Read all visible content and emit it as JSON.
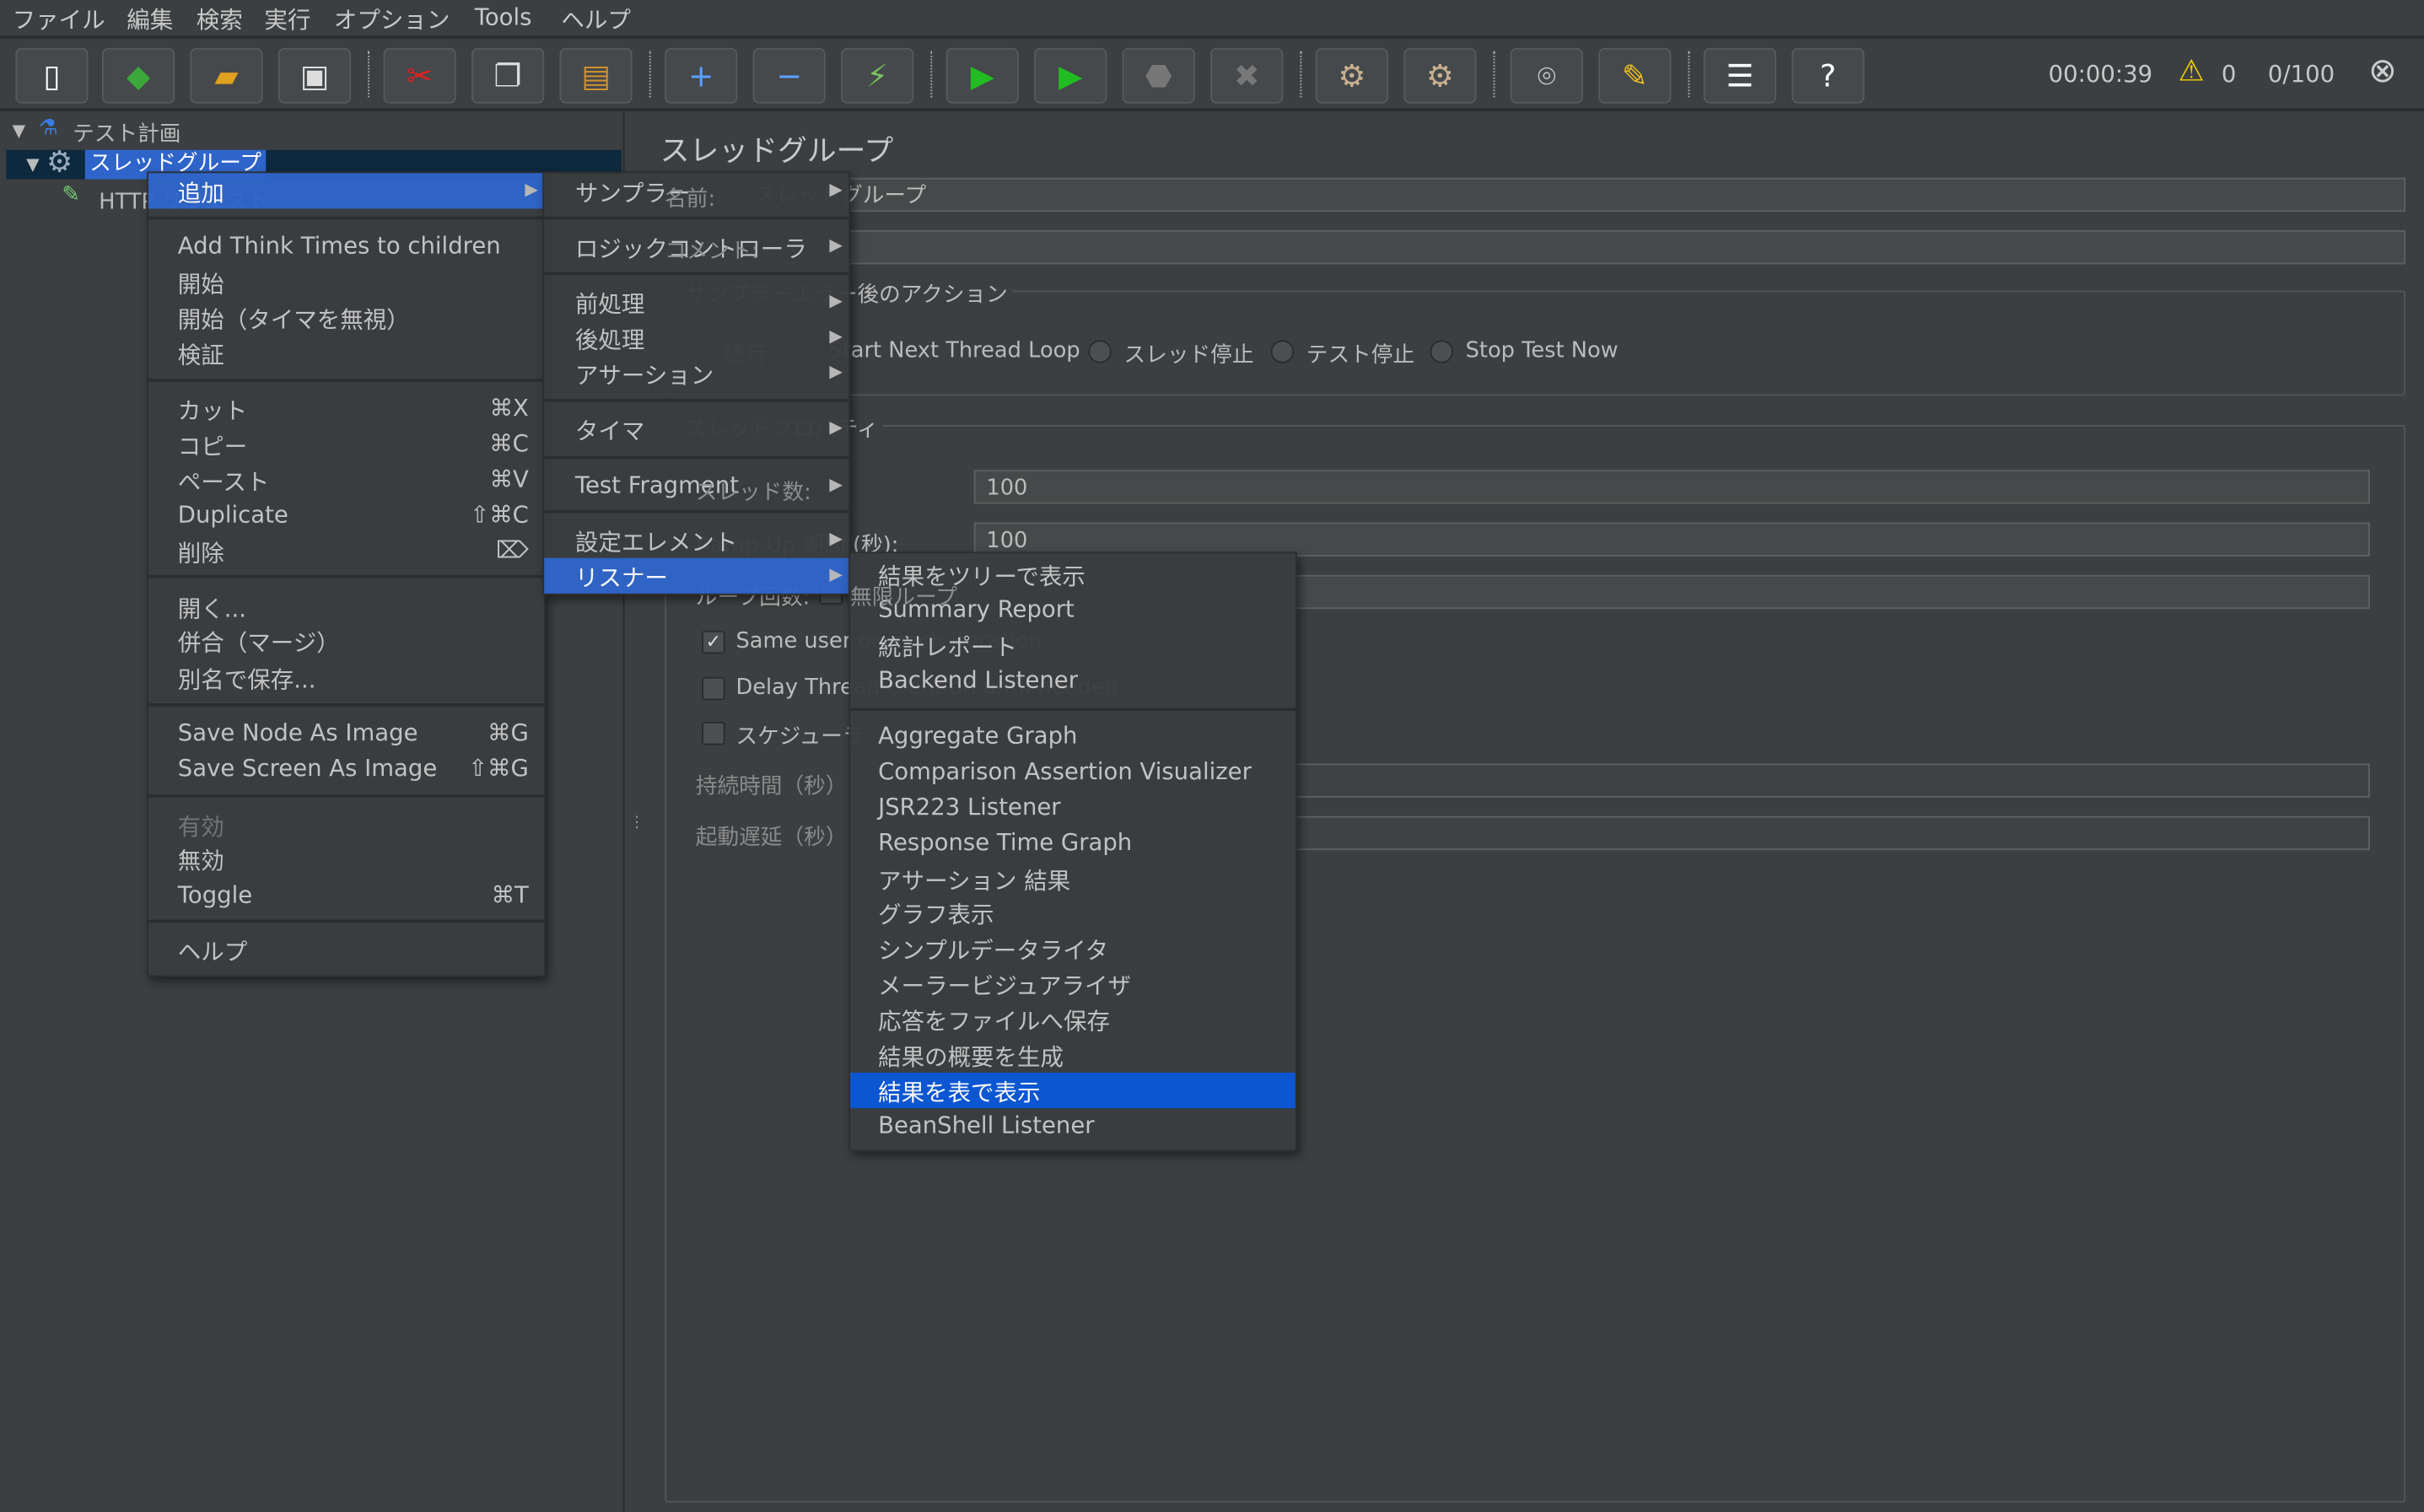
{
  "menubar": [
    "ファイル",
    "編集",
    "検索",
    "実行",
    "オプション",
    "Tools",
    "ヘルプ"
  ],
  "toolbar": {
    "buttons": [
      {
        "name": "new-icon",
        "glyph": "▯",
        "color": "#ffffff"
      },
      {
        "name": "templates-icon",
        "glyph": "◆",
        "color": "#3aa83a"
      },
      {
        "name": "open-icon",
        "glyph": "▰",
        "color": "#e0a020"
      },
      {
        "name": "save-icon",
        "glyph": "▣",
        "color": "#dddddd"
      },
      {
        "name": "cut-icon",
        "glyph": "✂",
        "color": "#e02020"
      },
      {
        "name": "copy-icon",
        "glyph": "❐",
        "color": "#dddddd"
      },
      {
        "name": "paste-icon",
        "glyph": "▤",
        "color": "#d09030"
      },
      {
        "name": "expand-icon",
        "glyph": "+",
        "color": "#5aa0ff"
      },
      {
        "name": "collapse-icon",
        "glyph": "−",
        "color": "#5aa0ff"
      },
      {
        "name": "toggle-icon",
        "glyph": "⚡",
        "color": "#7ac060"
      },
      {
        "name": "start-icon",
        "glyph": "▶",
        "color": "#22bb22"
      },
      {
        "name": "start-no-pause-icon",
        "glyph": "▶",
        "color": "#22bb22"
      },
      {
        "name": "stop-icon",
        "glyph": "⬣",
        "color": "#777777"
      },
      {
        "name": "shutdown-icon",
        "glyph": "✖",
        "color": "#777777"
      },
      {
        "name": "clear-icon",
        "glyph": "⚙",
        "color": "#c8b090"
      },
      {
        "name": "clear-all-icon",
        "glyph": "⚙",
        "color": "#c8b090"
      },
      {
        "name": "search-icon",
        "glyph": "⌾",
        "color": "#dddddd"
      },
      {
        "name": "reset-search-icon",
        "glyph": "✎",
        "color": "#f0c020"
      },
      {
        "name": "function-helper-icon",
        "glyph": "☰",
        "color": "#ffffff"
      },
      {
        "name": "help-icon",
        "glyph": "?",
        "color": "#ffffff"
      }
    ],
    "timer": "00:00:39",
    "warnings": "0",
    "threads": "0/100"
  },
  "tree": {
    "items": [
      "テスト計画",
      "スレッドグループ",
      "HTTP リクエスト"
    ]
  },
  "panel": {
    "title": "スレッドグループ",
    "name_label": "名前:",
    "name_value": "スレッドグループ",
    "comment_label": "コメント:",
    "error_section": "サンプラーエラー後のアクション",
    "radios": [
      "続行",
      "Start Next Thread Loop",
      "スレッド停止",
      "テスト停止",
      "Stop Test Now"
    ],
    "thread_section": "スレッドプロパティ",
    "threads_label": "スレッド数:",
    "threads_value": "100",
    "rampup_label": "Ramp-Up 期間 (秒):",
    "rampup_value": "100",
    "loop_label": "ループ回数:",
    "loop_infinite": "無限ループ",
    "same_user": "Same user on each iteration",
    "same_user_checked": true,
    "delay": "Delay Thread creation until needed",
    "scheduler": "スケジューラ",
    "duration_label": "持続時間（秒）",
    "startup_label": "起動遅延（秒）"
  },
  "menu1": [
    {
      "label": "追加",
      "submenu": true,
      "state": "highlighted"
    },
    {
      "sep": true
    },
    {
      "label": "Add Think Times to children"
    },
    {
      "label": "開始"
    },
    {
      "label": "開始（タイマを無視）"
    },
    {
      "label": "検証"
    },
    {
      "sep": true
    },
    {
      "label": "カット",
      "key": "⌘X"
    },
    {
      "label": "コピー",
      "key": "⌘C"
    },
    {
      "label": "ペースト",
      "key": "⌘V"
    },
    {
      "label": "Duplicate",
      "key": "⇧⌘C"
    },
    {
      "label": "削除",
      "key": "⌦"
    },
    {
      "sep": true
    },
    {
      "label": "開く..."
    },
    {
      "label": "併合（マージ）"
    },
    {
      "label": "別名で保存..."
    },
    {
      "sep": true
    },
    {
      "label": "Save Node As Image",
      "key": "⌘G"
    },
    {
      "label": "Save Screen As Image",
      "key": "⇧⌘G"
    },
    {
      "sep": true
    },
    {
      "label": "有効",
      "state": "disabled"
    },
    {
      "label": "無効"
    },
    {
      "label": "Toggle",
      "key": "⌘T"
    },
    {
      "sep": true
    },
    {
      "label": "ヘルプ"
    }
  ],
  "menu2": [
    {
      "label": "サンプラー",
      "submenu": true
    },
    {
      "sep": true
    },
    {
      "label": "ロジックコントローラ",
      "submenu": true
    },
    {
      "sep": true
    },
    {
      "label": "前処理",
      "submenu": true
    },
    {
      "label": "後処理",
      "submenu": true
    },
    {
      "label": "アサーション",
      "submenu": true
    },
    {
      "sep": true
    },
    {
      "label": "タイマ",
      "submenu": true
    },
    {
      "sep": true
    },
    {
      "label": "Test Fragment",
      "submenu": true
    },
    {
      "sep": true
    },
    {
      "label": "設定エレメント",
      "submenu": true
    },
    {
      "label": "リスナー",
      "submenu": true,
      "state": "highlighted"
    }
  ],
  "menu3": [
    {
      "label": "結果をツリーで表示"
    },
    {
      "label": "Summary Report"
    },
    {
      "label": "統計レポート"
    },
    {
      "label": "Backend Listener"
    },
    {
      "sep": true
    },
    {
      "label": "Aggregate Graph"
    },
    {
      "label": "Comparison Assertion Visualizer"
    },
    {
      "label": "JSR223 Listener"
    },
    {
      "label": "Response Time Graph"
    },
    {
      "label": "アサーション 結果"
    },
    {
      "label": "グラフ表示"
    },
    {
      "label": "シンプルデータライタ"
    },
    {
      "label": "メーラービジュアライザ"
    },
    {
      "label": "応答をファイルへ保存"
    },
    {
      "label": "結果の概要を生成"
    },
    {
      "label": "結果を表で表示",
      "state": "selected"
    },
    {
      "label": "BeanShell Listener"
    }
  ],
  "colors": {
    "background": "#3c3f41",
    "menu_highlight": "#2f65ca",
    "menu_selected": "#0b57d8",
    "tree_selection": "#0d293e"
  }
}
